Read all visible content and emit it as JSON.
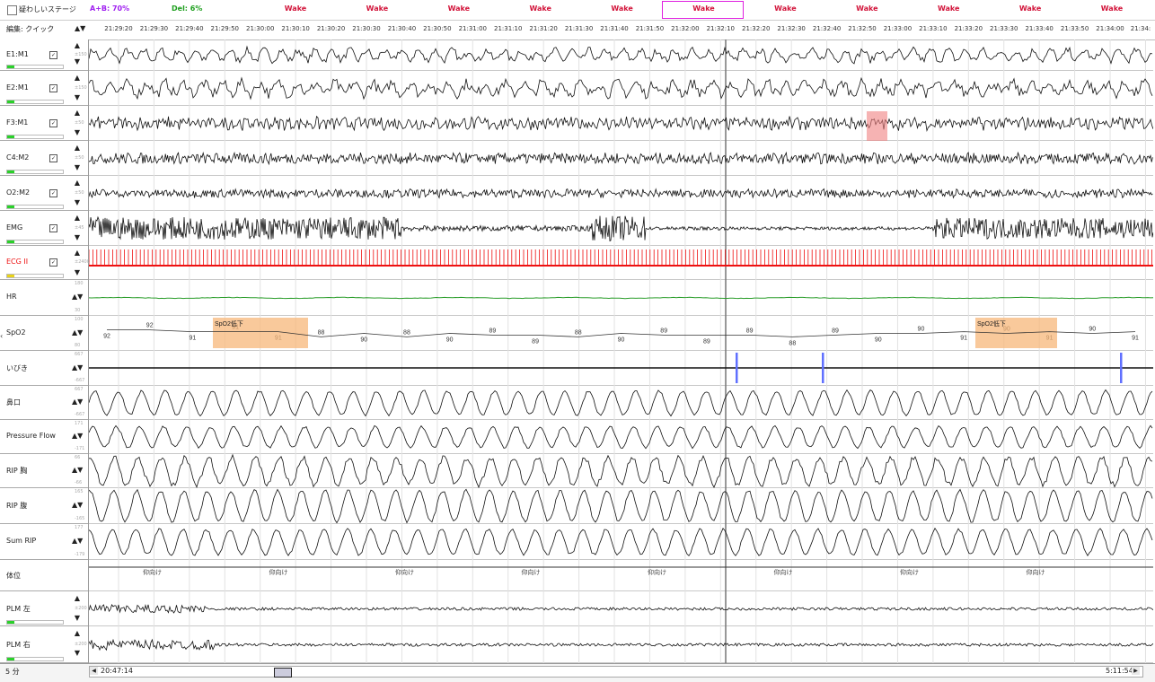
{
  "header": {
    "suspicious_stage_label": "疑わしいステージ",
    "ab_stat": "A+B: 70%",
    "del_stat": "Del: 6%",
    "edit_mode": "編集: クイック",
    "stages": [
      "Wake",
      "Wake",
      "Wake",
      "Wake",
      "Wake",
      "Wake",
      "Wake",
      "Wake",
      "Wake",
      "Wake",
      "Wake"
    ]
  },
  "time_axis": {
    "ticks": [
      "21:29:20",
      "21:29:30",
      "21:29:40",
      "21:29:50",
      "21:30:00",
      "21:30:10",
      "21:30:20",
      "21:30:30",
      "21:30:40",
      "21:30:50",
      "21:31:00",
      "21:31:10",
      "21:31:20",
      "21:31:30",
      "21:31:40",
      "21:31:50",
      "21:32:00",
      "21:32:10",
      "21:32:20",
      "21:32:30",
      "21:32:40",
      "21:32:50",
      "21:33:00",
      "21:33:10",
      "21:33:20",
      "21:33:30",
      "21:33:40",
      "21:33:50",
      "21:34:00",
      "21:34:"
    ]
  },
  "channels": [
    {
      "name": "E1:M1",
      "scale": "±150",
      "checked": true
    },
    {
      "name": "E2:M1",
      "scale": "±150",
      "checked": true
    },
    {
      "name": "F3:M1",
      "scale": "±50",
      "checked": true
    },
    {
      "name": "C4:M2",
      "scale": "±50",
      "checked": true
    },
    {
      "name": "O2:M2",
      "scale": "±50",
      "checked": true
    },
    {
      "name": "EMG",
      "scale": "±45",
      "checked": true
    },
    {
      "name": "ECG II",
      "scale": "±2400",
      "checked": true
    },
    {
      "name": "HR",
      "scale_top": "180",
      "scale_bottom": "30"
    },
    {
      "name": "SpO2",
      "scale_top": "100",
      "scale_bottom": "80"
    },
    {
      "name": "いびき",
      "scale_top": "667",
      "scale_bottom": "-667"
    },
    {
      "name": "鼻口",
      "scale_top": "667",
      "scale_bottom": "-667"
    },
    {
      "name": "Pressure Flow",
      "scale_top": "171",
      "scale_bottom": "-171"
    },
    {
      "name": "RIP 胸",
      "scale_top": "66",
      "scale_bottom": "-66"
    },
    {
      "name": "RIP 腹",
      "scale_top": "165",
      "scale_bottom": "-165"
    },
    {
      "name": "Sum RIP",
      "scale_top": "177",
      "scale_bottom": "-179"
    },
    {
      "name": "体位"
    },
    {
      "name": "PLM 左",
      "scale": "±200"
    },
    {
      "name": "PLM 右",
      "scale": "±200"
    }
  ],
  "spo2": {
    "values": [
      "92",
      "92",
      "91",
      "91",
      "91",
      "88",
      "90",
      "88",
      "90",
      "89",
      "89",
      "88",
      "90",
      "89",
      "89",
      "89",
      "88",
      "89",
      "90",
      "90",
      "91",
      "90",
      "91",
      "90",
      "91"
    ],
    "events": [
      {
        "label": "SpO2低下"
      },
      {
        "label": "SpO2低下"
      }
    ]
  },
  "position": {
    "labels": [
      "仰向け",
      "仰向け",
      "仰向け",
      "仰向け",
      "仰向け",
      "仰向け",
      "仰向け",
      "仰向け"
    ]
  },
  "footer": {
    "epoch": "5 分",
    "start_time": "20:47:14",
    "end_time": "5:11:54"
  },
  "colors": {
    "stage": "#d2143a",
    "ab": "#a020f0",
    "del": "#20a020",
    "ecg": "#ee1111",
    "hr": "#2a9d2a",
    "event": "#f7b77a",
    "arousal": "#f08080",
    "snore": "#6070ff",
    "selection": "#e020e0"
  }
}
